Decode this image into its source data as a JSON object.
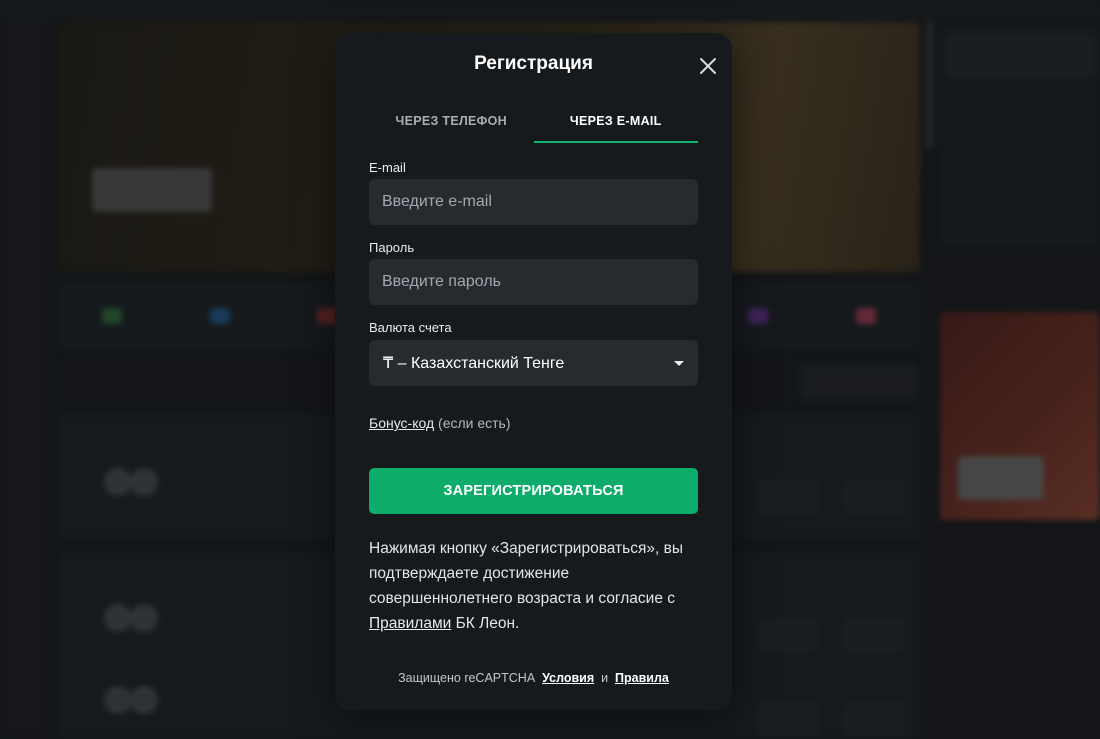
{
  "modal": {
    "title": "Регистрация",
    "close_icon": "close-icon",
    "tabs": [
      {
        "label": "ЧЕРЕЗ ТЕЛЕФОН",
        "active": false
      },
      {
        "label": "ЧЕРЕЗ E-MAIL",
        "active": true
      }
    ],
    "email": {
      "label": "E-mail",
      "placeholder": "Введите e-mail",
      "value": ""
    },
    "password": {
      "label": "Пароль",
      "placeholder": "Введите пароль",
      "value": ""
    },
    "currency": {
      "label": "Валюта счета",
      "value": "₸ – Казахстанский Тенге",
      "icon": "caret-down-icon"
    },
    "bonus": {
      "link": "Бонус-код",
      "note": "(если есть)"
    },
    "submit_label": "ЗАРЕГИСТРИРОВАТЬСЯ",
    "terms": {
      "text_before": "Нажимая кнопку «Зарегистрироваться», вы подтверждаете достижение совершеннолетнего возраста и согласие с ",
      "link": "Правилами",
      "text_after": " БК Леон."
    },
    "captcha": {
      "text": "Защищено reCAPTCHA",
      "terms_link": "Условия",
      "and": "и",
      "rules_link": "Правила"
    }
  },
  "colors": {
    "accent": "#0eac6a",
    "tab_underline": "#14b46e",
    "modal_bg": "#171a1d",
    "input_bg": "#272b30"
  }
}
